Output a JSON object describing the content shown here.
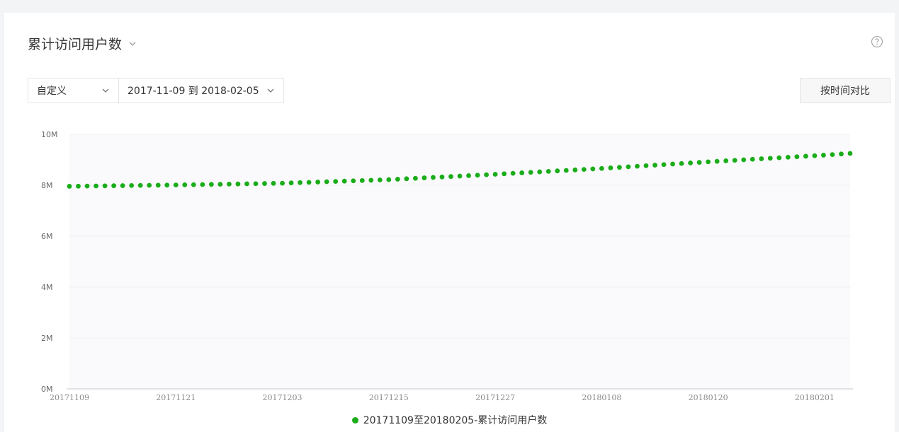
{
  "header": {
    "title": "累计访问用户数"
  },
  "controls": {
    "preset_label": "自定义",
    "date_range_label": "2017-11-09 到 2018-02-05",
    "compare_button_label": "按时间对比"
  },
  "colors": {
    "series": "#1aad19",
    "grid": "#f0f0f0",
    "plot_bg": "#fafafd"
  },
  "icons": {
    "title_dropdown": "chevron-down-icon",
    "help": "help-icon"
  },
  "chart_data": {
    "type": "scatter",
    "title": "",
    "xlabel": "",
    "ylabel": "",
    "ylim": [
      0,
      10000000
    ],
    "y_ticks": [
      0,
      2000000,
      4000000,
      6000000,
      8000000,
      10000000
    ],
    "y_tick_labels": [
      "0M",
      "2M",
      "4M",
      "6M",
      "8M",
      "10M"
    ],
    "x_ticks": [
      "20171109",
      "20171121",
      "20171203",
      "20171215",
      "20171227",
      "20180108",
      "20180120",
      "20180201"
    ],
    "x_start": "20171109",
    "x_end": "20180205",
    "grid": true,
    "legend_position": "bottom",
    "series": [
      {
        "name": "20171109至20180205-累计访问用户数",
        "start_value": 7960000,
        "end_value": 9250000,
        "anchors": [
          {
            "date": "20171109",
            "value": 7960000
          },
          {
            "date": "20171121",
            "value": 8010000
          },
          {
            "date": "20171203",
            "value": 8080000
          },
          {
            "date": "20171215",
            "value": 8220000
          },
          {
            "date": "20171227",
            "value": 8430000
          },
          {
            "date": "20180108",
            "value": 8660000
          },
          {
            "date": "20180120",
            "value": 8920000
          },
          {
            "date": "20180201",
            "value": 9160000
          },
          {
            "date": "20180205",
            "value": 9250000
          }
        ]
      }
    ]
  }
}
